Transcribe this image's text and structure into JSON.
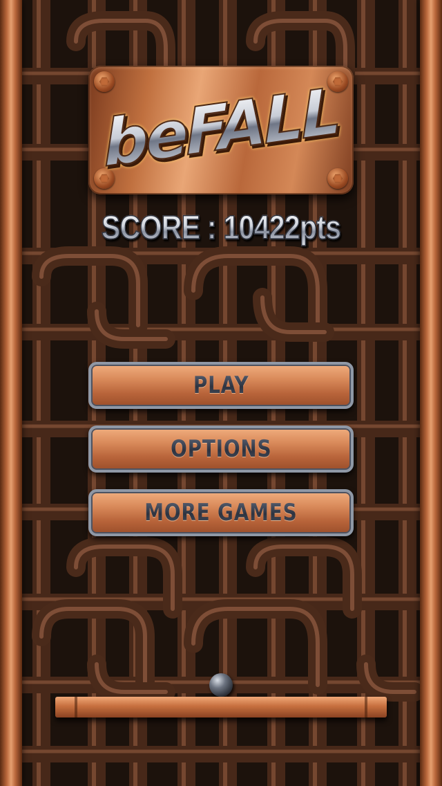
{
  "app": {
    "title": "beFALL"
  },
  "score": {
    "text": "SCORE : 10422pts"
  },
  "menu": {
    "play_label": "PLAY",
    "options_label": "OPTIONS",
    "more_games_label": "MORE GAMES"
  },
  "colors": {
    "copper_light": "#e9a676",
    "copper_dark": "#7a3a1e",
    "pipe_background": "#3b2418",
    "button_border": "#8f98a6",
    "button_text": "#2d3340"
  },
  "icons": {
    "ball": "steel-ball-icon",
    "bolt": "hex-bolt-icon"
  }
}
